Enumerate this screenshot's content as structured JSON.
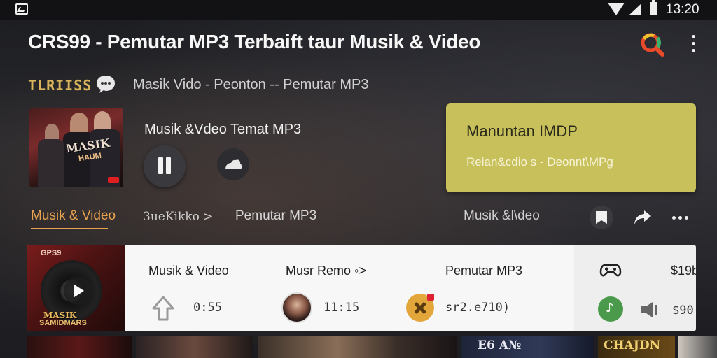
{
  "status_bar": {
    "time": "13:20"
  },
  "header": {
    "title": "CRS99 - Pemutar MP3 Terbaift taur Musik & Video"
  },
  "subheader": {
    "brand": "TLRIISS",
    "text": "Masik Vido - Peonton -- Pemutar MP3"
  },
  "now_playing": {
    "title": "Musik &Vdeo Temat MP3",
    "album_text": "MASIK",
    "album_text2": "HAUM"
  },
  "promo": {
    "title": "Manuntan IMDP",
    "subtitle": "Reian&cdio s - Deonnt\\MPg"
  },
  "tabs": [
    {
      "label": "Musik & Video"
    },
    {
      "label": "3ueKikko >"
    },
    {
      "label": "Pemutar MP3"
    },
    {
      "label": "Musik &l\\deo"
    }
  ],
  "list": {
    "thumb_tag": "GPS9",
    "thumb_caption": "MASIK",
    "thumb_caption2": "SAMIDMARS",
    "columns": [
      {
        "header": "Musik & Video",
        "value": "0:55"
      },
      {
        "header": "Musr Remo ◦>",
        "value": "11:15"
      },
      {
        "header": "Pemutar MP3",
        "value": "sr2.e710)"
      }
    ],
    "price_1": "$19b",
    "price_2": "$90"
  },
  "bottom_strip": {
    "label_1": "E6 A№",
    "label_2": "CHAJDN"
  },
  "colors": {
    "accent": "#e9a250",
    "promo_bg": "#c8c05a",
    "green": "#4b9a4b"
  },
  "icons": [
    "picture-icon",
    "wifi-icon",
    "signal-icon",
    "battery-icon",
    "search-icon",
    "more-vert-icon",
    "chat-icon",
    "pause-icon",
    "cast-icon",
    "bookmark-icon",
    "share-icon",
    "more-horiz-icon",
    "play-icon",
    "upload-arrow-icon",
    "tools-icon",
    "gamepad-icon",
    "music-note-icon",
    "volume-icon"
  ]
}
